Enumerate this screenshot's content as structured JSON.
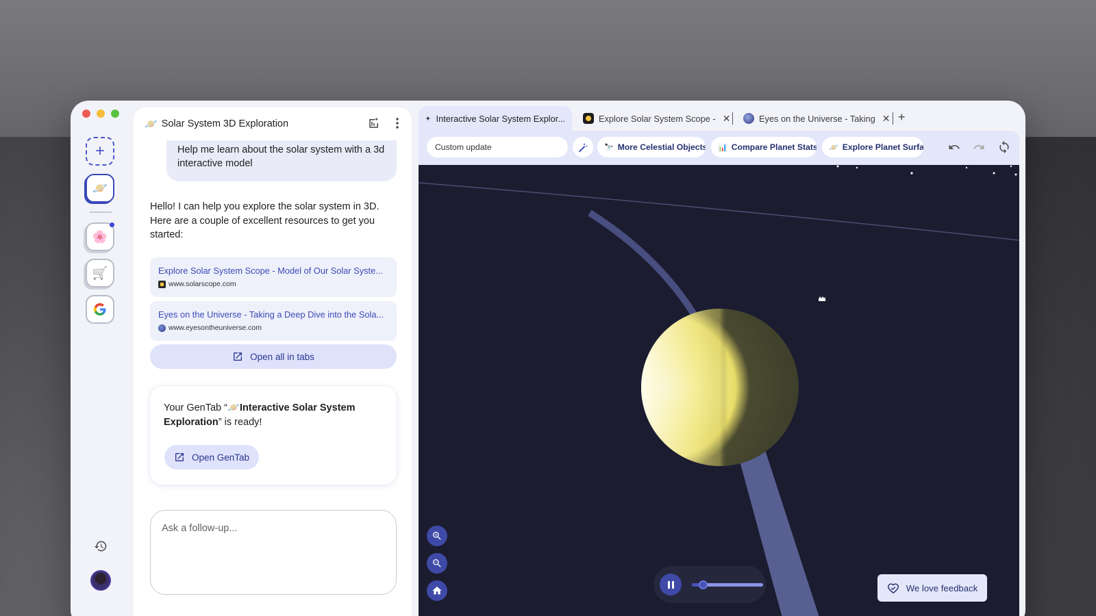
{
  "window": {
    "traffic_lights": [
      "close",
      "minimize",
      "zoom"
    ]
  },
  "rail": {
    "new_button_icon": "plus-icon",
    "items": [
      {
        "name": "active-gentab",
        "icon": "ringed-planet-emoji",
        "glyph": "🪐",
        "active": true
      },
      {
        "name": "flower-group",
        "icon": "cherry-blossom-emoji",
        "glyph": "🌸",
        "badge": true
      },
      {
        "name": "cart-group",
        "icon": "shopping-cart-emoji",
        "glyph": "🛒"
      },
      {
        "name": "google-group",
        "icon": "google-g-icon",
        "glyph": "G"
      }
    ],
    "history_icon": "history-icon",
    "avatar_icon": "user-avatar"
  },
  "chat": {
    "header": {
      "emoji": "🪐",
      "title": "Solar System 3D Exploration",
      "icons": [
        "add-tab-sparkle-icon",
        "more-vert-icon"
      ]
    },
    "user_message": "Help me learn about the solar system with a 3d interactive model",
    "assistant_message": "Hello! I can help you explore the solar system in 3D. Here are a couple of excellent resources to get you started:",
    "links": [
      {
        "title": "Explore Solar System Scope - Model of Our Solar Syste...",
        "url": "www.solarscope.com",
        "favicon_color": "#2b2b2b"
      },
      {
        "title": "Eyes on the Universe - Taking a Deep Dive into the Sola...",
        "url": "www.eyesontheuniverse.com",
        "favicon_color": "#4a5fa8"
      }
    ],
    "open_all_label": "Open all in tabs",
    "gentab": {
      "prefix": "Your GenTab “",
      "emoji": "🪐",
      "name": "Interactive Solar System Exploration",
      "suffix": "” is ready!",
      "button_label": "Open GenTab"
    },
    "followup_placeholder": "Ask a follow-up..."
  },
  "browser": {
    "tabs": [
      {
        "label": "Interactive Solar System Explor...",
        "icon": "sparkle-icon",
        "active": true
      },
      {
        "label": "Explore Solar System Scope -",
        "icon": "solarscope-favicon",
        "closable": true
      },
      {
        "label": "Eyes on the Universe - Taking",
        "icon": "eyes-favicon",
        "closable": true
      }
    ],
    "new_tab_label": "+",
    "toolbar": {
      "custom_update_label": "Custom update",
      "chips": [
        {
          "label": "More Celestial Objects",
          "icon": "telescope-emoji",
          "glyph": "🔭"
        },
        {
          "label": "Compare Planet Stats",
          "icon": "bar-chart-emoji",
          "glyph": "📊"
        },
        {
          "label": "Explore Planet Surfac",
          "icon": "ringed-planet-emoji",
          "glyph": "🪐"
        }
      ],
      "icons": [
        "undo-icon",
        "redo-icon",
        "sync-icon"
      ]
    },
    "viewer": {
      "controls": [
        "zoom-in-icon",
        "zoom-out-icon",
        "home-icon"
      ],
      "playback": {
        "state": "playing",
        "speed_fraction": 0.15
      },
      "feedback_label": "We love feedback",
      "colors": {
        "space": "#1b1c30",
        "accent": "#3f4aa8",
        "planet": "#f3ec8a"
      }
    }
  }
}
